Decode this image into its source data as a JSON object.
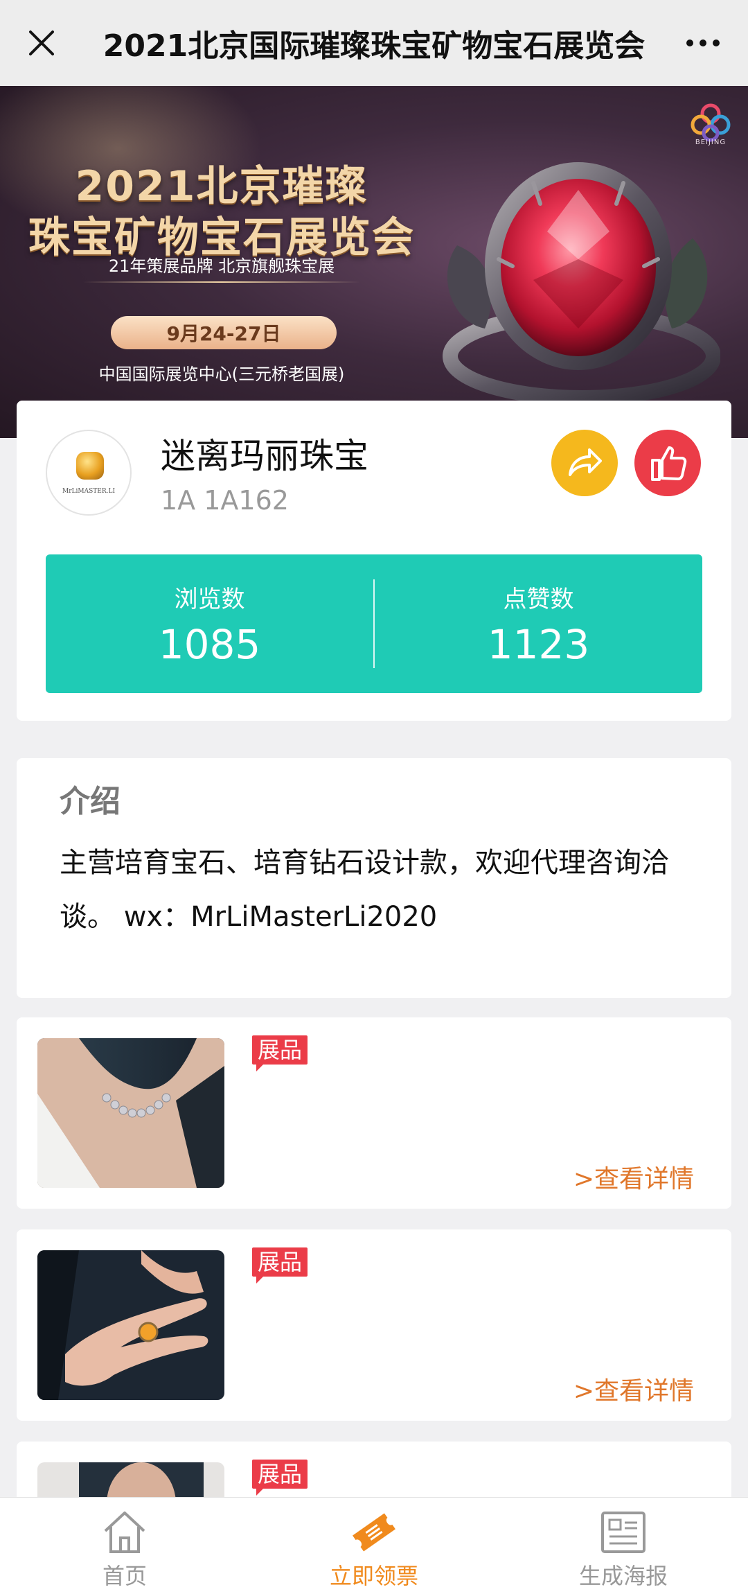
{
  "navbar": {
    "title": "2021北京国际璀璨珠宝矿物宝石展览会"
  },
  "banner": {
    "title_line1": "2021北京璀璨",
    "title_line2": "珠宝矿物宝石展览会",
    "slogan": "21年策展品牌  北京旗舰珠宝展",
    "date": "9月24-27日",
    "venue": "中国国际展览中心(三元桥老国展)",
    "logo_text": "BEIJING"
  },
  "exhibitor": {
    "avatar_text": "MrLiMASTER.LI",
    "name": "迷离玛丽珠宝",
    "booth": "1A 1A162",
    "stats": {
      "views_label": "浏览数",
      "views_value": "1085",
      "likes_label": "点赞数",
      "likes_value": "1123"
    }
  },
  "intro": {
    "heading": "介绍",
    "body": "主营培育宝石、培育钻石设计款，欢迎代理咨询洽谈。 wx：MrLiMasterLi2020"
  },
  "products": [
    {
      "tag": "展品",
      "link": ">查看详情",
      "image": "pearl-necklace-photo"
    },
    {
      "tag": "展品",
      "link": ">查看详情",
      "image": "ring-on-hand-photo"
    },
    {
      "tag": "展品",
      "image": "portrait-photo"
    }
  ],
  "tabbar": {
    "items": [
      {
        "label": "首页",
        "icon": "home-icon"
      },
      {
        "label": "立即领票",
        "icon": "ticket-icon"
      },
      {
        "label": "生成海报",
        "icon": "poster-icon"
      }
    ],
    "active_index": 1
  },
  "colors": {
    "stats_bg": "#1fcbb5",
    "share": "#f5b81d",
    "like": "#eb3c48",
    "tab_active": "#f08a1d",
    "link": "#e0772b"
  }
}
